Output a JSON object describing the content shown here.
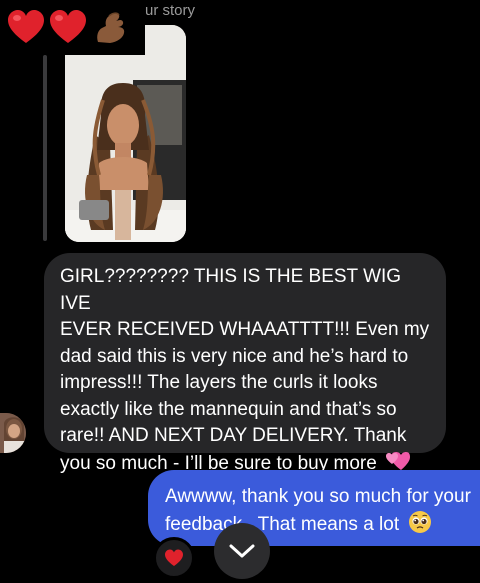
{
  "header": {
    "overlay_emojis": [
      "heart-icon",
      "heart-icon",
      "pinching-hand-icon"
    ],
    "story_label": "ur story"
  },
  "incoming_message": {
    "lines": [
      "GIRL???????? THIS IS THE BEST WIG IVE",
      "EVER RECEIVED WHAAATTTT!!! Even my",
      "dad said this is very nice and he’s hard to",
      "impress!!! The layers the curls it looks",
      "exactly like the mannequin and that’s so",
      "rare!! AND NEXT DAY DELIVERY. Thank",
      "you so much - I’ll be sure to buy more"
    ],
    "trailing_emoji": "two-hearts-icon"
  },
  "outgoing_message": {
    "lines": [
      "Awwww, thank you so much for your",
      "feedback . That means a lot"
    ],
    "trailing_emoji": "pleading-face-icon"
  },
  "reaction": {
    "emoji": "heart-icon"
  },
  "colors": {
    "background": "#000000",
    "incoming_bubble": "#262628",
    "outgoing_bubble": "#3b5bdb",
    "heart": "#e0222c"
  }
}
